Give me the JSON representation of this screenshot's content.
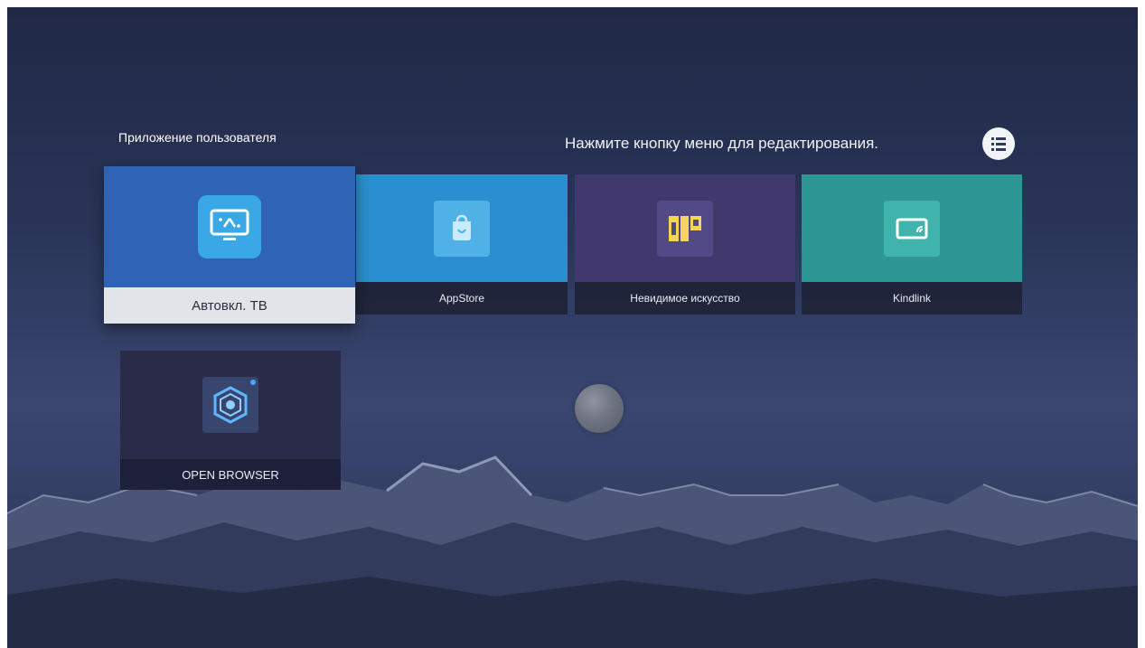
{
  "section_title": "Приложение пользователя",
  "hint": "Нажмите кнопку меню для редактирования.",
  "menu_icon": "list-menu-icon",
  "apps": [
    {
      "name": "Автовкл. ТВ",
      "icon": "tv-monitor-icon",
      "color": "#2f63b4",
      "focused": true
    },
    {
      "name": "AppStore",
      "icon": "store-bag-icon",
      "color": "#2a8fcf"
    },
    {
      "name": "Невидимое искусство",
      "icon": "art-frames-icon",
      "color": "#41386d"
    },
    {
      "name": "Kindlink",
      "icon": "screen-cast-icon",
      "color": "#2d9796"
    },
    {
      "name": "OPEN BROWSER",
      "icon": "hexagon-browser-icon",
      "color": "#2a2a49"
    }
  ]
}
